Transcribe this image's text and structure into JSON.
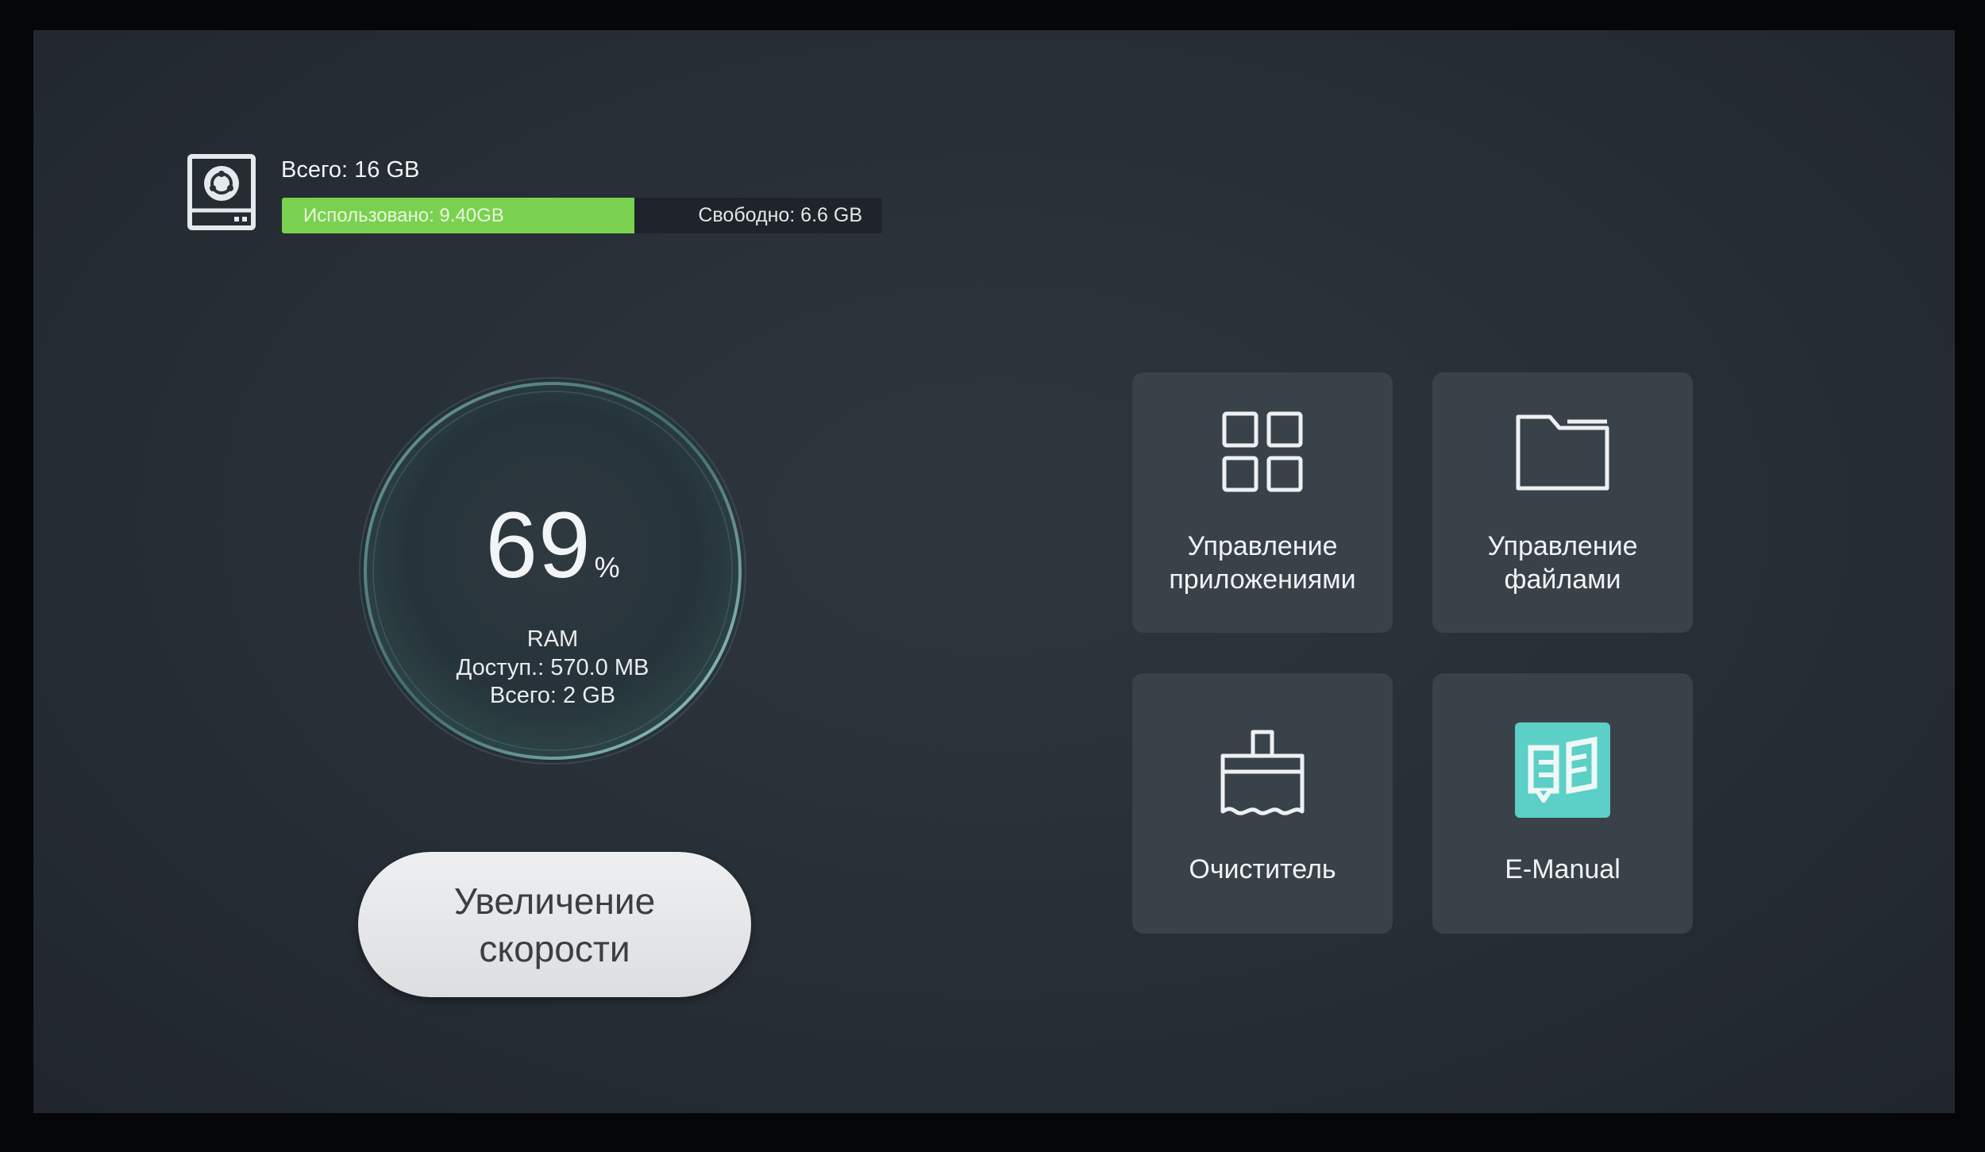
{
  "storage": {
    "total_label": "Всего: 16 GB",
    "used_label": "Использовано: 9.40GB",
    "free_label": "Свободно: 6.6 GB",
    "used_fraction": 0.5875,
    "used_color": "#7ad14f"
  },
  "ram": {
    "percent": "69",
    "percent_unit": "%",
    "label": "RAM",
    "available": "Доступ.: 570.0 MB",
    "total": "Всего: 2 GB"
  },
  "speedup_button": {
    "label": "Увеличение скорости"
  },
  "tiles": [
    {
      "label": "Управление приложениями",
      "icon": "grid-icon"
    },
    {
      "label": "Управление файлами",
      "icon": "folder-icon"
    },
    {
      "label": "Очиститель",
      "icon": "brush-icon"
    },
    {
      "label": "E-Manual",
      "icon": "book-icon",
      "icon_color": "#5ccfc6"
    }
  ]
}
